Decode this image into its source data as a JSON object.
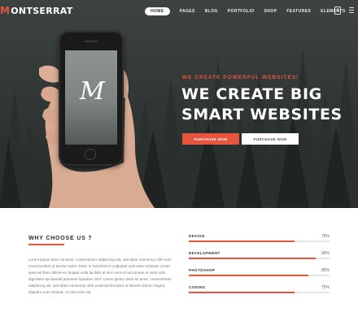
{
  "brand": {
    "logo_mark": "M",
    "logo_text": "ONTSERRAT",
    "accent_color": "#e8553e"
  },
  "nav": {
    "items": [
      {
        "label": "HOME",
        "active": true
      },
      {
        "label": "PAGES",
        "active": false
      },
      {
        "label": "BLOG",
        "active": false
      },
      {
        "label": "PORTFOLIO",
        "active": false
      },
      {
        "label": "SHOP",
        "active": false
      },
      {
        "label": "FEATURES",
        "active": false
      },
      {
        "label": "ELEMENTS",
        "active": false
      }
    ],
    "cart_count": "0",
    "cart_icon": "shopping-bag-icon",
    "menu_icon": "hamburger-menu-icon"
  },
  "hero": {
    "phone_logo": "M",
    "tagline": "WE CREATE POWERFUL WEBSITES!",
    "headline_line1": "WE CREATE BIG",
    "headline_line2": "SMART WEBSITES",
    "primary_button": "PURCHASE NOW",
    "secondary_button": "PURCHASE NOW"
  },
  "why": {
    "title": "WHY CHOOSE US ?",
    "body": "Lorem ipsum dolor sit amet, consectetuer adipiscing elit, sed diam nonummy nibh euis mod tincidunt ut laoreet dolor. Dolor in hendrerit in vulputate velit esse molestie conse quat vel illum dolore eu feugiat nulla facilisis at vero eros et accumsan et iusto odio dignissim qui blandit praesent luptatum zzril. Lorem ipsum dolor sit amet, consectetuer adipiscing elit, sed diam nonummy nibh euismod tincidunt ut laoreet dolore magna aliquam erat volutpat. Ut wisi enim ad"
  },
  "skills": [
    {
      "label": "DESIGN",
      "percent": 75,
      "percent_label": "75%"
    },
    {
      "label": "DEVELOPMENT",
      "percent": 90,
      "percent_label": "90%"
    },
    {
      "label": "PHOTOSHOP",
      "percent": 85,
      "percent_label": "85%"
    },
    {
      "label": "CODING",
      "percent": 75,
      "percent_label": "75%"
    }
  ]
}
